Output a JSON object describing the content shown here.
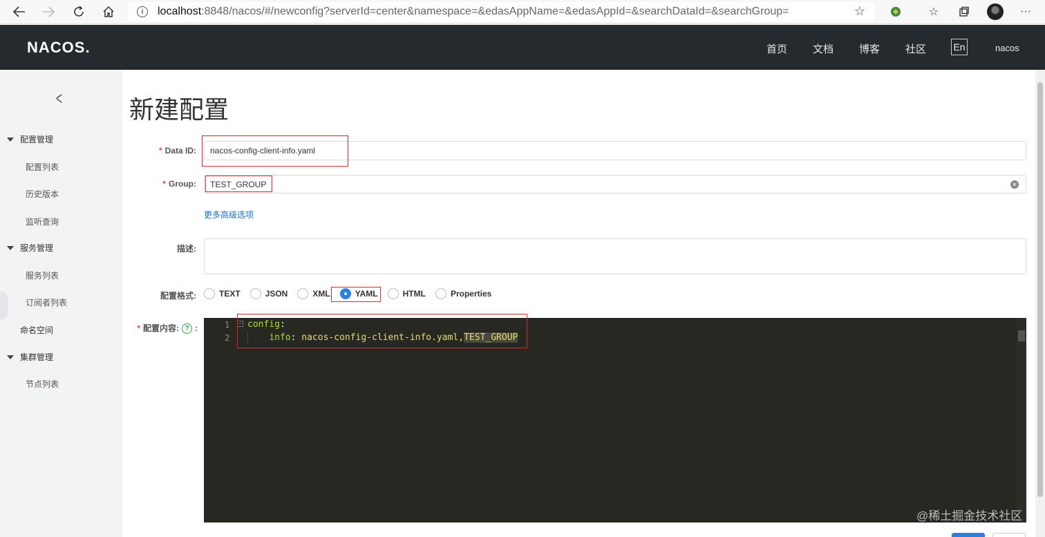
{
  "browser": {
    "url_host": "localhost",
    "url_path": ":8848/nacos/#/newconfig?serverId=center&namespace=&edasAppName=&edasAppId=&searchDataId=&searchGroup=",
    "back_icon": "back-arrow-icon",
    "forward_icon": "forward-arrow-icon",
    "refresh_icon": "refresh-icon",
    "home_icon": "home-icon"
  },
  "header": {
    "logo": "NACOS.",
    "nav": [
      "首页",
      "文档",
      "博客",
      "社区"
    ],
    "lang": "En",
    "user": "nacos"
  },
  "sidebar": {
    "groups": [
      {
        "label": "配置管理",
        "items": [
          "配置列表",
          "历史版本",
          "监听查询"
        ]
      },
      {
        "label": "服务管理",
        "items": [
          "服务列表",
          "订阅者列表"
        ]
      },
      {
        "label": "命名空间"
      },
      {
        "label": "集群管理",
        "items": [
          "节点列表"
        ]
      }
    ]
  },
  "form": {
    "title": "新建配置",
    "data_id_label": "Data ID:",
    "data_id_value": "nacos-config-client-info.yaml",
    "group_label": "Group:",
    "group_value": "TEST_GROUP",
    "advanced_link": "更多高级选项",
    "desc_label": "描述:",
    "format_label": "配置格式:",
    "formats": [
      "TEXT",
      "JSON",
      "XML",
      "YAML",
      "HTML",
      "Properties"
    ],
    "selected_format": "YAML",
    "content_label": "配置内容:",
    "content_colon": ":",
    "required_mark": "*"
  },
  "editor": {
    "line_numbers": [
      "1",
      "2"
    ],
    "line1_key": "config",
    "line1_colon": ":",
    "line2_indent": "    ",
    "line2_key": "info",
    "line2_sep": ": ",
    "line2_value": "nacos-config-client-info.yaml,",
    "line2_highlight": "TEST_GROUP"
  },
  "watermark": "@稀土掘金技术社区"
}
